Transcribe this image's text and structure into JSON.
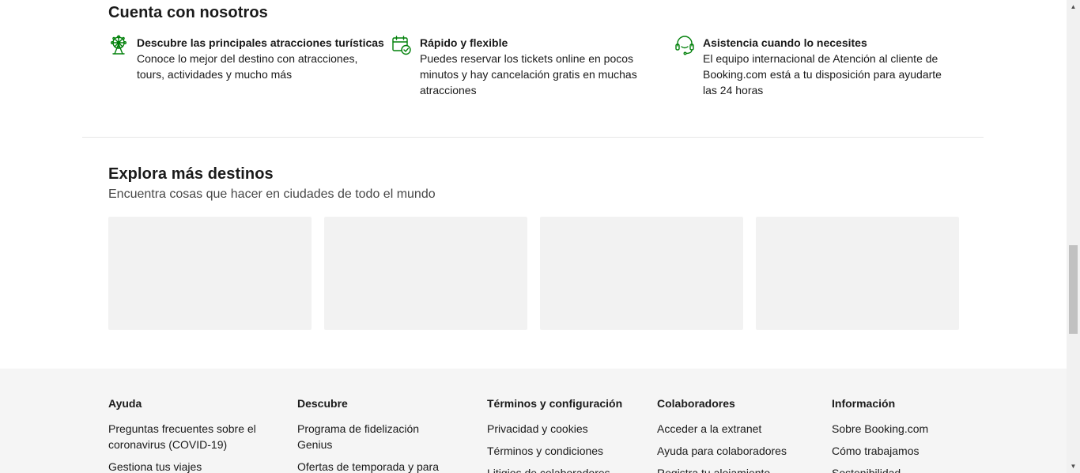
{
  "trust": {
    "title": "Cuenta con nosotros",
    "features": [
      {
        "icon": "ferris-wheel-icon",
        "title": "Descubre las principales atracciones turísticas",
        "desc": "Conoce lo mejor del destino con atracciones, tours, actividades y mucho más"
      },
      {
        "icon": "calendar-check-icon",
        "title": "Rápido y flexible",
        "desc": "Puedes reservar los tickets online en pocos minutos y hay cancelación gratis en muchas atracciones"
      },
      {
        "icon": "headset-icon",
        "title": "Asistencia cuando lo necesites",
        "desc": "El equipo internacional de Atención al cliente de Booking.com está a tu disposición para ayudarte las 24 horas"
      }
    ],
    "icon_color": "#008009"
  },
  "explore": {
    "title": "Explora más destinos",
    "subtitle": "Encuentra cosas que hacer en ciudades de todo el mundo"
  },
  "footer": {
    "columns": [
      {
        "heading": "Ayuda",
        "links": [
          "Preguntas frecuentes sobre el coronavirus (COVID-19)",
          "Gestiona tus viajes"
        ]
      },
      {
        "heading": "Descubre",
        "links": [
          "Programa de fidelización Genius",
          "Ofertas de temporada y para"
        ]
      },
      {
        "heading": "Términos y configuración",
        "links": [
          "Privacidad y cookies",
          "Términos y condiciones",
          "Litigios de colaboradores"
        ]
      },
      {
        "heading": "Colaboradores",
        "links": [
          "Acceder a la extranet",
          "Ayuda para colaboradores",
          "Registra tu alojamiento"
        ]
      },
      {
        "heading": "Información",
        "links": [
          "Sobre Booking.com",
          "Cómo trabajamos",
          "Sostenibilidad"
        ]
      }
    ]
  }
}
